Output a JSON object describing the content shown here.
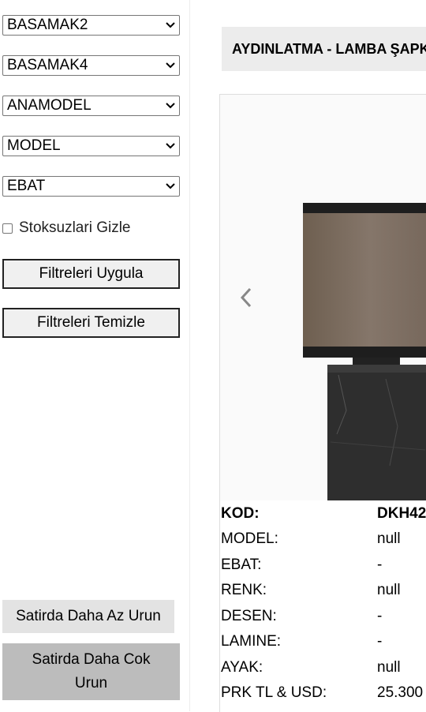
{
  "filters": {
    "selects": [
      "BASAMAK2",
      "BASAMAK4",
      "ANAMODEL",
      "MODEL",
      "EBAT"
    ],
    "hide_out_of_stock_label": "Stoksuzlari Gizle",
    "apply_label": "Filtreleri Uygula",
    "clear_label": "Filtreleri Temizle"
  },
  "layout_buttons": {
    "fewer_label": "Satirda Daha Az Urun",
    "more_label": "Satirda Daha Cok Urun"
  },
  "category": {
    "title": "AYDINLATMA - LAMBA ŞAPKASI"
  },
  "product": {
    "rows": [
      {
        "key": "KOD:",
        "value": "DKH42"
      },
      {
        "key": "MODEL:",
        "value": "null"
      },
      {
        "key": "EBAT:",
        "value": "-"
      },
      {
        "key": "RENK:",
        "value": "null"
      },
      {
        "key": "DESEN:",
        "value": "-"
      },
      {
        "key": "LAMINE:",
        "value": "-"
      },
      {
        "key": "AYAK:",
        "value": "null"
      },
      {
        "key": "PRK TL & USD:",
        "value": "25.300"
      }
    ]
  },
  "icons": {
    "prev": "chevron-left-icon",
    "dropdown": "chevron-down-icon"
  },
  "colors": {
    "shade": "#7a6a5a",
    "shade_band": "#1e1e1e",
    "base": "#2f2f2f"
  }
}
